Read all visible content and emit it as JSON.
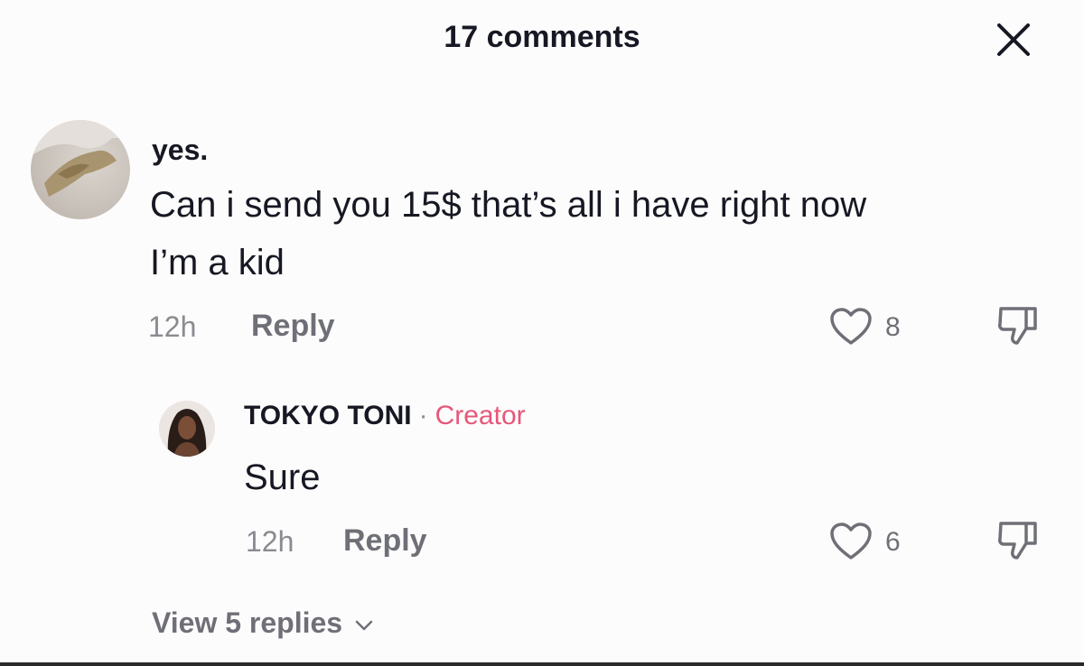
{
  "header": {
    "title": "17 comments",
    "close_icon": "close-icon"
  },
  "comment": {
    "username": "yes.",
    "text_line1": "Can i send you 15$ that’s all i have right now",
    "text_line2": "I’m a kid",
    "time": "12h",
    "reply_label": "Reply",
    "likes": "8",
    "like_icon": "heart-outline-icon",
    "dislike_icon": "thumbs-down-icon"
  },
  "reply": {
    "username": "TOKYO TONI",
    "separator": "·",
    "badge": "Creator",
    "text": "Sure",
    "time": "12h",
    "reply_label": "Reply",
    "likes": "6"
  },
  "view_replies": {
    "label": "View 5 replies",
    "icon": "chevron-down-icon"
  },
  "colors": {
    "accent": "#e5587a",
    "text": "#161823",
    "muted": "#8a8b91"
  }
}
